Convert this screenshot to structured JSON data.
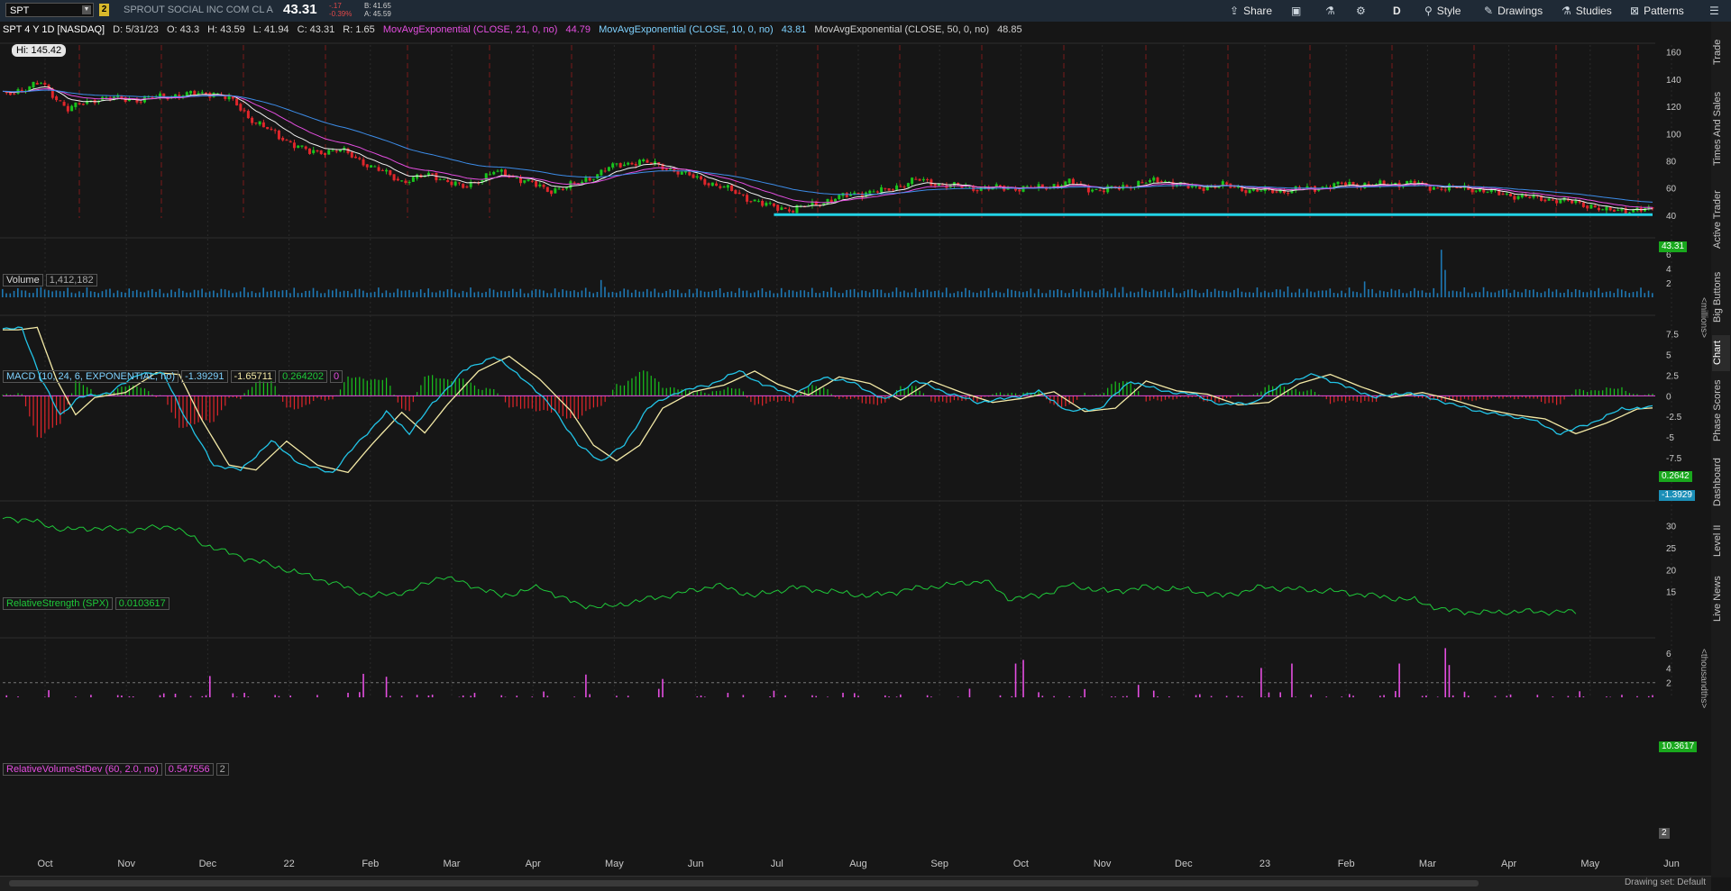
{
  "toolbar": {
    "symbol": "SPT",
    "link_badge": "2",
    "description": "SPROUT SOCIAL INC COM CL A",
    "last": "43.31",
    "change": "-.17",
    "change_pct": "-0.39%",
    "bid": "B: 41.65",
    "ask": "A: 45.59",
    "share": "Share",
    "timeframe": "D",
    "style": "Style",
    "drawings": "Drawings",
    "studies": "Studies",
    "patterns": "Patterns"
  },
  "chart_header": {
    "title": "SPT 4 Y 1D [NASDAQ]",
    "d": "D: 5/31/23",
    "o": "O: 43.3",
    "h": "H: 43.59",
    "l": "L: 41.94",
    "c": "C: 43.31",
    "r": "R: 1.65",
    "ema21_label": "MovAvgExponential (CLOSE, 21, 0, no)",
    "ema21_value": "44.79",
    "ema10_label": "MovAvgExponential (CLOSE, 10, 0, no)",
    "ema10_value": "43.81",
    "ema50_label": "MovAvgExponential (CLOSE, 50, 0, no)",
    "ema50_value": "48.85"
  },
  "hi_label": "Hi: 145.42",
  "sidebar_tabs": [
    "Trade",
    "Times And Sales",
    "Active Trader",
    "Big Buttons",
    "Chart",
    "Phase Scores",
    "Dashboard",
    "Level II",
    "Live News"
  ],
  "volume_pane": {
    "label": "Volume",
    "value": "1,412,182",
    "unit": "<millions>"
  },
  "macd_pane": {
    "label": "MACD (10, 24, 6, EXPONENTIAL, no)",
    "v1": "-1.39291",
    "v2": "-1.65711",
    "v3": "0.264202",
    "v4": "0",
    "tag_hist": "0.2642",
    "tag_macd": "-1.3929"
  },
  "rs_pane": {
    "label": "RelativeStrength (SPX)",
    "value": "0.0103617",
    "tag": "10.3617",
    "unit": "<thousandths>"
  },
  "rvol_pane": {
    "label": "RelativeVolumeStDev (60, 2.0, no)",
    "value": "0.547556",
    "v2": "2",
    "tag": "2"
  },
  "price_tag": "43.31",
  "bottom": {
    "drawing_set": "Drawing set: Default"
  },
  "colors": {
    "up": "#19c41d",
    "down": "#e0262b",
    "ema21": "#e44ee0",
    "ema10": "#f0f0f0",
    "ema50": "#3c8ce8",
    "support": "#22d3e6",
    "macd": "#22c3e6",
    "signal": "#f3e9a6",
    "rs": "#1fc83a",
    "rvol": "#e44ee0"
  },
  "chart_data": [
    {
      "type": "candlestick",
      "title": "SPT 4 Y 1D [NASDAQ]",
      "x_ticks": [
        "Oct",
        "Nov",
        "Dec",
        "22",
        "Feb",
        "Mar",
        "Apr",
        "May",
        "Jun",
        "Jul",
        "Aug",
        "Sep",
        "Oct",
        "Nov",
        "Dec",
        "23",
        "Feb",
        "Mar",
        "Apr",
        "May",
        "Jun"
      ],
      "y_ticks": [
        40,
        60,
        80,
        100,
        120,
        140,
        160
      ],
      "ylim": [
        38,
        165
      ],
      "close_path": [
        [
          0,
          128
        ],
        [
          10,
          137
        ],
        [
          17,
          118
        ],
        [
          25,
          126
        ],
        [
          35,
          125
        ],
        [
          45,
          128
        ],
        [
          55,
          130
        ],
        [
          60,
          124
        ],
        [
          65,
          110
        ],
        [
          72,
          98
        ],
        [
          80,
          86
        ],
        [
          88,
          88
        ],
        [
          96,
          76
        ],
        [
          104,
          65
        ],
        [
          112,
          70
        ],
        [
          120,
          60
        ],
        [
          128,
          72
        ],
        [
          136,
          66
        ],
        [
          142,
          58
        ],
        [
          150,
          63
        ],
        [
          158,
          75
        ],
        [
          166,
          80
        ],
        [
          174,
          74
        ],
        [
          182,
          66
        ],
        [
          190,
          58
        ],
        [
          198,
          48
        ],
        [
          206,
          44
        ],
        [
          214,
          50
        ],
        [
          222,
          56
        ],
        [
          230,
          58
        ],
        [
          238,
          66
        ],
        [
          246,
          62
        ],
        [
          254,
          60
        ],
        [
          262,
          60
        ],
        [
          270,
          60
        ],
        [
          278,
          64
        ],
        [
          286,
          58
        ],
        [
          294,
          62
        ],
        [
          302,
          66
        ],
        [
          310,
          60
        ],
        [
          318,
          62
        ],
        [
          326,
          58
        ],
        [
          334,
          58
        ],
        [
          342,
          60
        ],
        [
          350,
          63
        ],
        [
          358,
          62
        ],
        [
          366,
          64
        ],
        [
          374,
          60
        ],
        [
          382,
          60
        ],
        [
          390,
          56
        ],
        [
          398,
          53
        ],
        [
          406,
          51
        ],
        [
          414,
          47
        ],
        [
          418,
          43
        ],
        [
          422,
          44
        ]
      ],
      "hi": 145.42,
      "last": 43.31,
      "support_level": 40.5
    },
    {
      "type": "bar",
      "title": "Volume",
      "y_ticks": [
        2,
        4,
        6
      ],
      "ylim": [
        0,
        7
      ],
      "unit": "millions",
      "spikes": [
        [
          156,
          2.4
        ],
        [
          375,
          6.6
        ],
        [
          376,
          3.8
        ],
        [
          10,
          1.4
        ],
        [
          290,
          1.3
        ],
        [
          335,
          1.5
        ],
        [
          355,
          2.2
        ]
      ]
    },
    {
      "type": "line",
      "title": "MACD (10, 24, 6, EXPONENTIAL, no)",
      "y_ticks": [
        -10,
        -7.5,
        -5,
        -2.5,
        0,
        2.5,
        5,
        7.5
      ],
      "ylim": [
        -11,
        9
      ],
      "macd": [
        [
          0,
          8
        ],
        [
          5,
          8.3
        ],
        [
          10,
          2
        ],
        [
          15,
          -2.3
        ],
        [
          20,
          -0.2
        ],
        [
          28,
          0.4
        ],
        [
          36,
          2.8
        ],
        [
          42,
          2.6
        ],
        [
          48,
          -3
        ],
        [
          55,
          -8.4
        ],
        [
          62,
          -9
        ],
        [
          70,
          -5.5
        ],
        [
          78,
          -8.4
        ],
        [
          86,
          -9.3
        ],
        [
          92,
          -6
        ],
        [
          100,
          -2
        ],
        [
          106,
          -4.5
        ],
        [
          112,
          -1
        ],
        [
          120,
          3
        ],
        [
          128,
          4.8
        ],
        [
          136,
          2
        ],
        [
          144,
          -1.8
        ],
        [
          150,
          -6
        ],
        [
          156,
          -7.9
        ],
        [
          162,
          -6
        ],
        [
          168,
          -1.5
        ],
        [
          176,
          0.5
        ],
        [
          184,
          1.3
        ],
        [
          192,
          3
        ],
        [
          198,
          1.4
        ],
        [
          206,
          0.1
        ],
        [
          214,
          2.3
        ],
        [
          222,
          1.5
        ],
        [
          230,
          -0.5
        ],
        [
          238,
          1.8
        ],
        [
          246,
          0.4
        ],
        [
          254,
          -0.8
        ],
        [
          262,
          -0.3
        ],
        [
          270,
          0.5
        ],
        [
          278,
          -1.9
        ],
        [
          286,
          -1.5
        ],
        [
          294,
          1.8
        ],
        [
          302,
          0.6
        ],
        [
          310,
          0.2
        ],
        [
          318,
          -1.1
        ],
        [
          326,
          -0.8
        ],
        [
          334,
          1.5
        ],
        [
          342,
          2.6
        ],
        [
          350,
          1.1
        ],
        [
          358,
          -0.2
        ],
        [
          366,
          0.4
        ],
        [
          374,
          -0.5
        ],
        [
          382,
          -1.6
        ],
        [
          390,
          -2.3
        ],
        [
          398,
          -2.8
        ],
        [
          406,
          -4.6
        ],
        [
          414,
          -3.3
        ],
        [
          422,
          -1.6
        ],
        [
          428,
          -1.4
        ]
      ],
      "signal_offset": 4,
      "last_macd": -1.3929,
      "last_hist": 0.2642
    },
    {
      "type": "line",
      "title": "RelativeStrength (SPX)",
      "y_ticks": [
        15,
        20,
        25,
        30
      ],
      "ylim": [
        9,
        34
      ],
      "unit": "thousandths",
      "values": [
        [
          0,
          32
        ],
        [
          8,
          31
        ],
        [
          16,
          29
        ],
        [
          24,
          29.5
        ],
        [
          34,
          29
        ],
        [
          44,
          30
        ],
        [
          52,
          26
        ],
        [
          58,
          24
        ],
        [
          66,
          22
        ],
        [
          76,
          19.5
        ],
        [
          86,
          17
        ],
        [
          96,
          14
        ],
        [
          106,
          15
        ],
        [
          114,
          18.5
        ],
        [
          122,
          16.5
        ],
        [
          130,
          14
        ],
        [
          140,
          16
        ],
        [
          150,
          12
        ],
        [
          158,
          11.5
        ],
        [
          166,
          13
        ],
        [
          176,
          14.5
        ],
        [
          186,
          16.5
        ],
        [
          196,
          14
        ],
        [
          206,
          16
        ],
        [
          216,
          15
        ],
        [
          226,
          14
        ],
        [
          236,
          15.5
        ],
        [
          246,
          16.5
        ],
        [
          256,
          17.5
        ],
        [
          262,
          13.5
        ],
        [
          270,
          14
        ],
        [
          278,
          16.5
        ],
        [
          288,
          15
        ],
        [
          298,
          16
        ],
        [
          308,
          15.5
        ],
        [
          318,
          14
        ],
        [
          328,
          16
        ],
        [
          338,
          15.5
        ],
        [
          348,
          15
        ],
        [
          358,
          14
        ],
        [
          368,
          13
        ],
        [
          376,
          10.8
        ],
        [
          386,
          10.2
        ],
        [
          396,
          10.5
        ],
        [
          404,
          10.4
        ],
        [
          410,
          10.36
        ]
      ],
      "last": 10.3617
    },
    {
      "type": "bar",
      "title": "RelativeVolumeStDev (60, 2.0, no)",
      "y_ticks": [
        2,
        4,
        6
      ],
      "ylim": [
        0,
        7
      ],
      "threshold": 2,
      "spikes": [
        [
          94,
          3.2
        ],
        [
          100,
          2.8
        ],
        [
          152,
          3.1
        ],
        [
          172,
          2.5
        ],
        [
          264,
          4.6
        ],
        [
          266,
          5.1
        ],
        [
          296,
          1.7
        ],
        [
          328,
          4
        ],
        [
          336,
          4.6
        ],
        [
          364,
          4.6
        ],
        [
          376,
          6.7
        ],
        [
          377,
          4.4
        ],
        [
          54,
          2.9
        ]
      ]
    }
  ]
}
